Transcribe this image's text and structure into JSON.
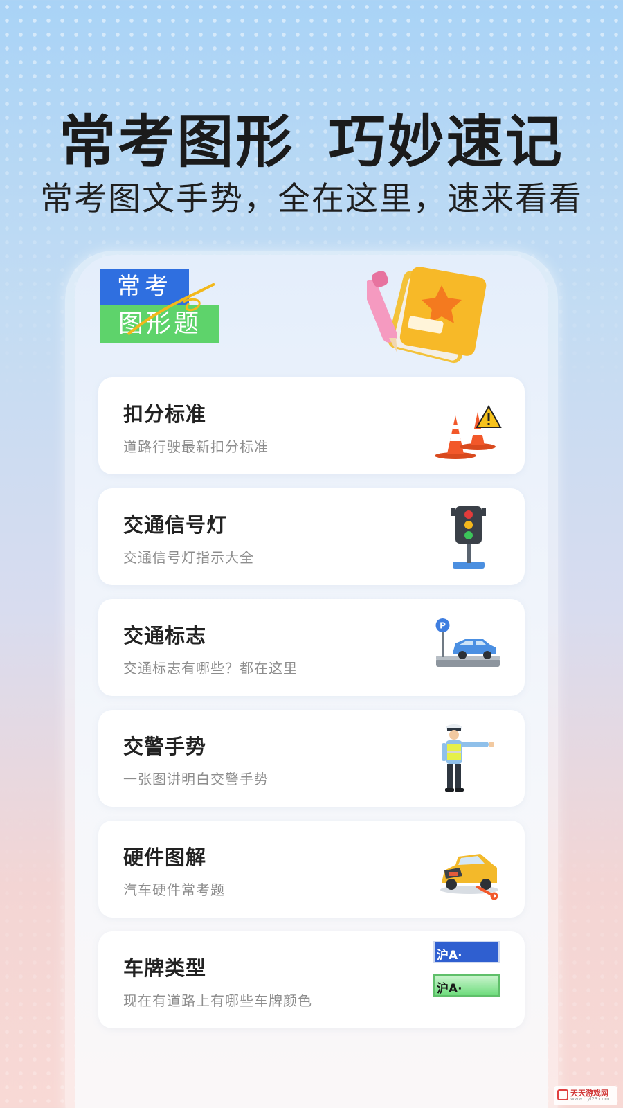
{
  "hero": {
    "headline": "常考图形 巧妙速记",
    "subline": "常考图文手势，全在这里，速来看看"
  },
  "logo": {
    "line1": "常考",
    "line2": "图形题"
  },
  "cards": [
    {
      "title": "扣分标准",
      "desc": "道路行驶最新扣分标准",
      "icon": "traffic-cones-icon"
    },
    {
      "title": "交通信号灯",
      "desc": "交通信号灯指示大全",
      "icon": "traffic-light-icon"
    },
    {
      "title": "交通标志",
      "desc": "交通标志有哪些？都在这里",
      "icon": "parking-car-icon"
    },
    {
      "title": "交警手势",
      "desc": "一张图讲明白交警手势",
      "icon": "traffic-police-icon"
    },
    {
      "title": "硬件图解",
      "desc": "汽车硬件常考题",
      "icon": "car-repair-icon"
    },
    {
      "title": "车牌类型",
      "desc": "现在有道路上有哪些车牌颜色",
      "icon": "license-plates-icon"
    }
  ],
  "plates": {
    "blue": "沪A·",
    "green": "沪A·"
  },
  "watermark": {
    "text": "天天游戏网",
    "url": "www.ttyl23.com"
  },
  "colors": {
    "plate_blue": "#2f5fd0",
    "plate_green": "#7ee08a",
    "cone_orange": "#f2582a",
    "accent_yellow": "#f6b81b"
  }
}
